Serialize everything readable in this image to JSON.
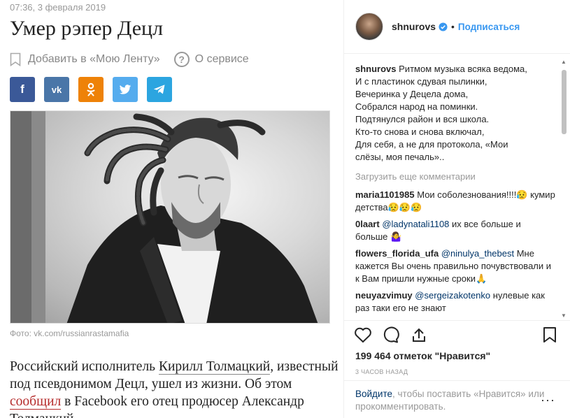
{
  "article": {
    "timestamp": "07:36, 3 февраля 2019",
    "title": "Умер рэпер Децл",
    "add_to_feed": "Добавить в «Мою Ленту»",
    "about_service": "О сервисе",
    "share": [
      {
        "network": "facebook",
        "label": "f",
        "color": "#3b5998"
      },
      {
        "network": "vk",
        "label": "vk",
        "color": "#4a76a8"
      },
      {
        "network": "odnoklassniki",
        "label": "ok",
        "color": "#ee8208"
      },
      {
        "network": "twitter",
        "label": "tw",
        "color": "#55acee"
      },
      {
        "network": "telegram",
        "label": "tg",
        "color": "#2ca5e0"
      }
    ],
    "photo_credit": "Фото: vk.com/russianrastamafia",
    "body": {
      "t1": "Российский исполнитель ",
      "link1": "Кирилл Толмацкий",
      "t2": ", известный под псевдонимом Децл, ушел из жизни. Об этом ",
      "link2": "сообщил",
      "t3": " в Facebook его отец продюсер Александр Толмацкий."
    }
  },
  "instagram": {
    "username": "shnurovs",
    "follow": "Подписаться",
    "caption": {
      "user": "shnurovs",
      "lines": [
        "Ритмом музыка всяка ведома,",
        "И с пластинок сдувая пылинки,",
        "Вечеринка у Децела дома,",
        "Собрался народ на поминки.",
        "Подтянулся район и вся школа.",
        "Кто-то снова и снова включал,",
        "Для себя, а не для протокола, «Мои",
        "слёзы, моя печаль».."
      ]
    },
    "load_more": "Загрузить еще комментарии",
    "comments": [
      {
        "user": "maria1101985",
        "mention": "",
        "text": "Мои соболезнования!!!!😥 кумир детства😥😥😥"
      },
      {
        "user": "0laart",
        "mention": "@ladynatali1108",
        "text": " их все больше и больше 🤷‍♀️"
      },
      {
        "user": "flowers_florida_ufa",
        "mention": "@ninulya_thebest",
        "text": " Мне кажется Вы очень правильно почувствовали и к Вам пришли нужные сроки🙏"
      },
      {
        "user": "neuyazvimuy",
        "mention": "@sergeizakotenko",
        "text": " нулевые как раз таки его не знают"
      }
    ],
    "likes": "199 464 отметок \"Нравится\"",
    "time_ago": "3 часов назад",
    "login": {
      "link": "Войдите",
      "text": ", чтобы поставить «Нравится» или прокомментировать."
    },
    "more": "···"
  }
}
